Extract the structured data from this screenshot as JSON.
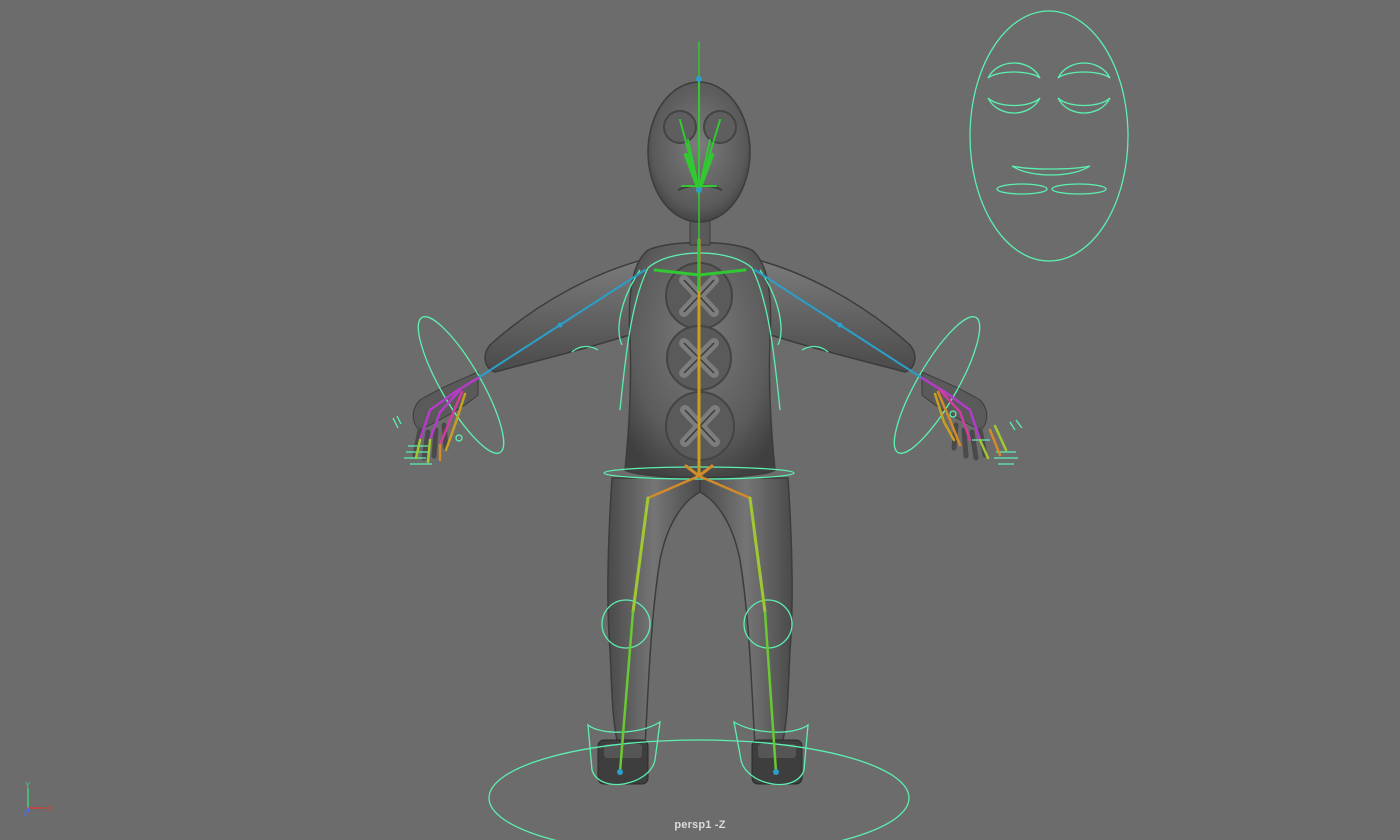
{
  "viewport": {
    "camera_label": "persp1 -Z",
    "background_color": "#6c6c6c"
  },
  "axis_gizmo": {
    "x_label": "X",
    "y_label": "Y",
    "z_label": "Z",
    "x_color": "#d23b3b",
    "y_color": "#3fd17a",
    "z_color": "#4a6cf0"
  },
  "colors": {
    "control_curve": "#5cf0b0",
    "body_fill": "#5e5e5e",
    "body_stroke": "#3e3e3e",
    "spine_joint": "#c8a020",
    "neck_joint": "#32c832",
    "arm_joint": "#2aa0c8",
    "hand_joint": "#b43cc8",
    "leg_joint": "#a0c832",
    "hip_joint": "#d28a2a"
  }
}
